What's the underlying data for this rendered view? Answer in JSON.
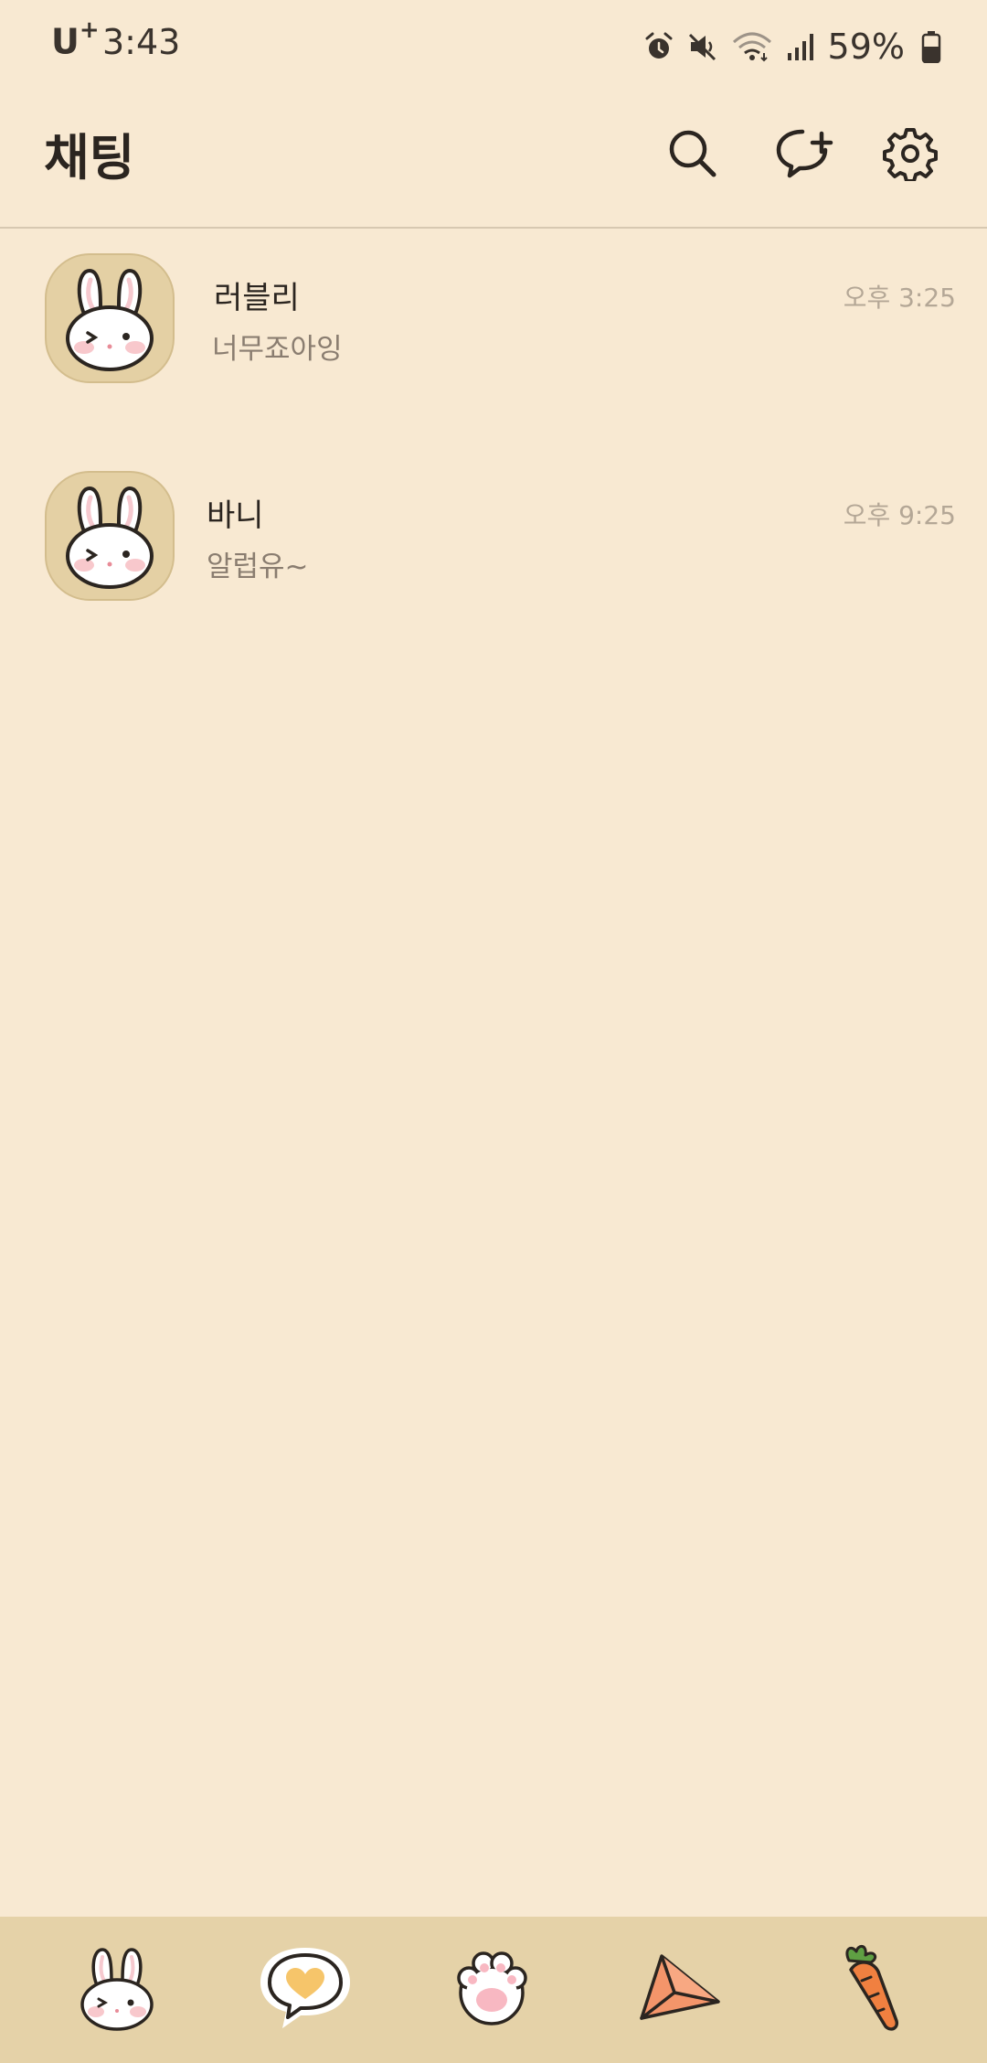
{
  "status_bar": {
    "carrier": "U",
    "carrier_sup": "+",
    "time": "3:43",
    "battery": "59%",
    "icons": [
      "alarm-icon",
      "mute-icon",
      "wifi-icon",
      "signal-icon",
      "battery-icon"
    ]
  },
  "header": {
    "title": "채팅",
    "actions": [
      "search-icon",
      "new-chat-icon",
      "settings-icon"
    ]
  },
  "chats": [
    {
      "name": "러블리",
      "preview": "너무죠아잉",
      "time": "오후 3:25",
      "avatar": "bunny-avatar"
    },
    {
      "name": "바니",
      "preview": "알럽유~",
      "time": "오후 9:25",
      "avatar": "bunny-avatar"
    }
  ],
  "bottom_nav": {
    "items": [
      "bunny-friends-icon",
      "heart-chat-icon",
      "paw-icon",
      "paper-plane-icon",
      "carrot-icon"
    ],
    "active_index": 1
  },
  "colors": {
    "background": "#f8e9d2",
    "nav_background": "#e5d2a8",
    "avatar_background": "#e4d0a4",
    "divider": "#d7c8b1"
  }
}
